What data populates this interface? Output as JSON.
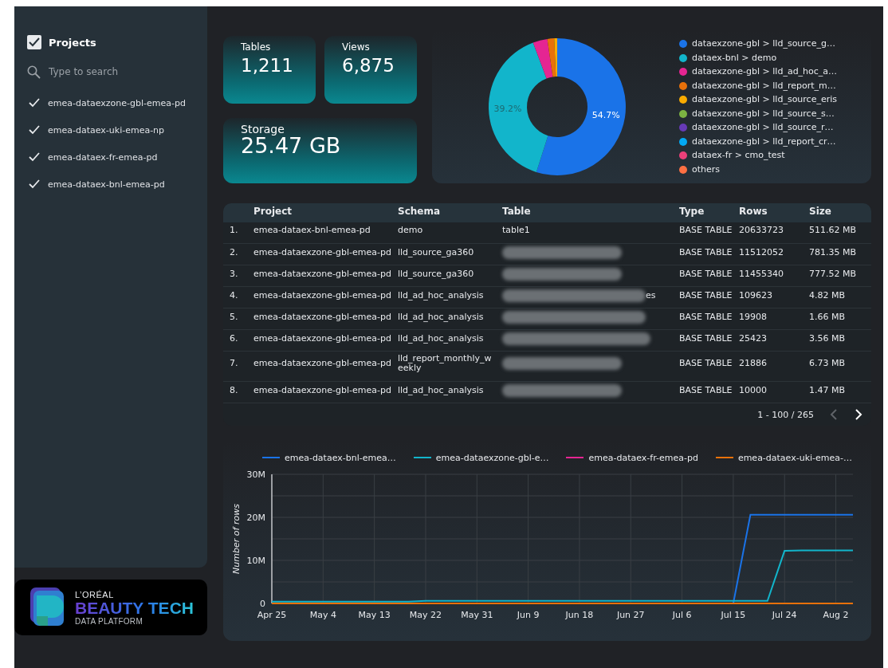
{
  "sidebar": {
    "title": "Projects",
    "all_checked": true,
    "search": {
      "placeholder": "Type to search"
    },
    "items": [
      {
        "label": "emea-dataexzone-gbl-emea-pd",
        "selected": true
      },
      {
        "label": "emea-dataex-uki-emea-np",
        "selected": true
      },
      {
        "label": "emea-dataex-fr-emea-pd",
        "selected": true
      },
      {
        "label": "emea-dataex-bnl-emea-pd",
        "selected": true
      }
    ]
  },
  "logo": {
    "brand": "L’ORÉAL",
    "product": "BEAUTY TECH",
    "subtitle": "DATA PLATFORM"
  },
  "kpis": [
    {
      "label": "Tables",
      "value": "1,211"
    },
    {
      "label": "Views",
      "value": "6,875"
    },
    {
      "label": "Storage",
      "value": "25.47 GB"
    }
  ],
  "donut": {
    "chart_data": {
      "type": "donut",
      "categories": [
        "dataexzone-gbl > lld_source_g…",
        "dataex-bnl > demo",
        "dataexzone-gbl > lld_ad_hoc_a…",
        "dataexzone-gbl > lld_report_m…",
        "dataexzone-gbl > lld_source_eris",
        "dataexzone-gbl > lld_source_s…",
        "dataexzone-gbl > lld_source_r…",
        "dataexzone-gbl > lld_report_cr…",
        "dataex-fr > cmo_test",
        "others"
      ],
      "values": [
        54.7,
        39.2,
        3.4,
        1.6,
        0.7,
        null,
        null,
        null,
        null,
        null
      ],
      "colors": [
        "#1a73e8",
        "#12b5cb",
        "#e52592",
        "#e8710a",
        "#f9ab00",
        "#7cb342",
        "#673ab7",
        "#03a9f4",
        "#ec407a",
        "#ff7043"
      ],
      "value_labels": [
        "54.7%",
        "39.2%",
        null,
        null,
        null,
        null,
        null,
        null,
        null,
        null
      ]
    }
  },
  "table": {
    "columns": [
      "Project",
      "Schema",
      "Table",
      "Type",
      "Rows",
      "Size"
    ],
    "rows": [
      {
        "number": "1.",
        "project": "emea-dataex-bnl-emea-pd",
        "schema": "demo",
        "table": "table1",
        "redacted": false,
        "type": "BASE TABLE",
        "rows": "20633723",
        "size": "511.62 MB"
      },
      {
        "number": "2.",
        "project": "emea-dataexzone-gbl-emea-pd",
        "schema": "lld_source_ga360",
        "redacted": true,
        "type": "BASE TABLE",
        "rows": "11512052",
        "size": "781.35 MB"
      },
      {
        "number": "3.",
        "project": "emea-dataexzone-gbl-emea-pd",
        "schema": "lld_source_ga360",
        "redacted": true,
        "type": "BASE TABLE",
        "rows": "11455340",
        "size": "777.52 MB"
      },
      {
        "number": "4.",
        "project": "emea-dataexzone-gbl-emea-pd",
        "schema": "lld_ad_hoc_analysis",
        "table": "es",
        "redacted": true,
        "type": "BASE TABLE",
        "rows": "109623",
        "size": "4.82 MB"
      },
      {
        "number": "5.",
        "project": "emea-dataexzone-gbl-emea-pd",
        "schema": "lld_ad_hoc_analysis",
        "redacted": true,
        "type": "BASE TABLE",
        "rows": "19908",
        "size": "1.66 MB"
      },
      {
        "number": "6.",
        "project": "emea-dataexzone-gbl-emea-pd",
        "schema": "lld_ad_hoc_analysis",
        "redacted": true,
        "type": "BASE TABLE",
        "rows": "25423",
        "size": "3.56 MB"
      },
      {
        "number": "7.",
        "project": "emea-dataexzone-gbl-emea-pd",
        "schema": "lld_report_monthly_weekly",
        "redacted": true,
        "type": "BASE TABLE",
        "rows": "21886",
        "size": "6.73 MB"
      },
      {
        "number": "8.",
        "project": "emea-dataexzone-gbl-emea-pd",
        "schema": "lld_ad_hoc_analysis",
        "redacted": true,
        "type": "BASE TABLE",
        "rows": "10000",
        "size": "1.47 MB"
      }
    ],
    "pagination": {
      "range": "1 - 100 / 265",
      "prev_disabled": true,
      "next_disabled": false
    }
  },
  "line_chart": {
    "chart_data": {
      "type": "line",
      "ylabel": "Number of rows",
      "categories": [
        "Apr 25",
        null,
        null,
        "May 4",
        null,
        null,
        "May 13",
        null,
        null,
        "May 22",
        null,
        null,
        "May 31",
        null,
        null,
        "Jun 9",
        null,
        null,
        "Jun 18",
        null,
        null,
        "Jun 27",
        null,
        null,
        "Jul 6",
        null,
        null,
        "Jul 15",
        null,
        null,
        "Jul 24",
        null,
        null,
        "Aug 2",
        null
      ],
      "ylim": [
        0,
        30000000
      ],
      "grid": true,
      "yticks": [
        {
          "value": 0,
          "label": "0"
        },
        {
          "value": 10000000,
          "label": "10M"
        },
        {
          "value": 20000000,
          "label": "20M"
        },
        {
          "value": 30000000,
          "label": "30M"
        }
      ],
      "series": [
        {
          "name": "emea-dataex-bnl-emea…",
          "color": "#1a73e8",
          "values": [
            null,
            null,
            null,
            null,
            null,
            null,
            null,
            null,
            null,
            null,
            null,
            null,
            null,
            null,
            null,
            null,
            null,
            null,
            null,
            null,
            null,
            null,
            null,
            null,
            null,
            null,
            null,
            0,
            20600000,
            20600000,
            20600000,
            20600000,
            20600000,
            20600000,
            20600000
          ]
        },
        {
          "name": "emea-dataexzone-gbl-e…",
          "color": "#12b5cb",
          "values": [
            400000,
            400000,
            400000,
            400000,
            400000,
            400000,
            400000,
            400000,
            400000,
            600000,
            600000,
            600000,
            600000,
            600000,
            600000,
            600000,
            600000,
            600000,
            600000,
            600000,
            600000,
            600000,
            600000,
            600000,
            600000,
            600000,
            600000,
            600000,
            600000,
            600000,
            12200000,
            12300000,
            12300000,
            12300000,
            12300000
          ]
        },
        {
          "name": "emea-dataex-fr-emea-pd",
          "color": "#e52592",
          "values": [
            null,
            null,
            null,
            null,
            null,
            null,
            null,
            null,
            null,
            null,
            null,
            null,
            null,
            null,
            null,
            null,
            null,
            null,
            null,
            null,
            null,
            null,
            null,
            null,
            null,
            null,
            null,
            null,
            null,
            null,
            null,
            null,
            null,
            null,
            null
          ]
        },
        {
          "name": "emea-dataex-uki-emea-…",
          "color": "#e8710a",
          "values": [
            0,
            0,
            0,
            0,
            0,
            0,
            0,
            0,
            0,
            0,
            0,
            0,
            0,
            0,
            0,
            0,
            0,
            0,
            0,
            0,
            0,
            0,
            0,
            0,
            0,
            0,
            0,
            0,
            0,
            0,
            0,
            0,
            0,
            0,
            0
          ]
        }
      ]
    }
  }
}
